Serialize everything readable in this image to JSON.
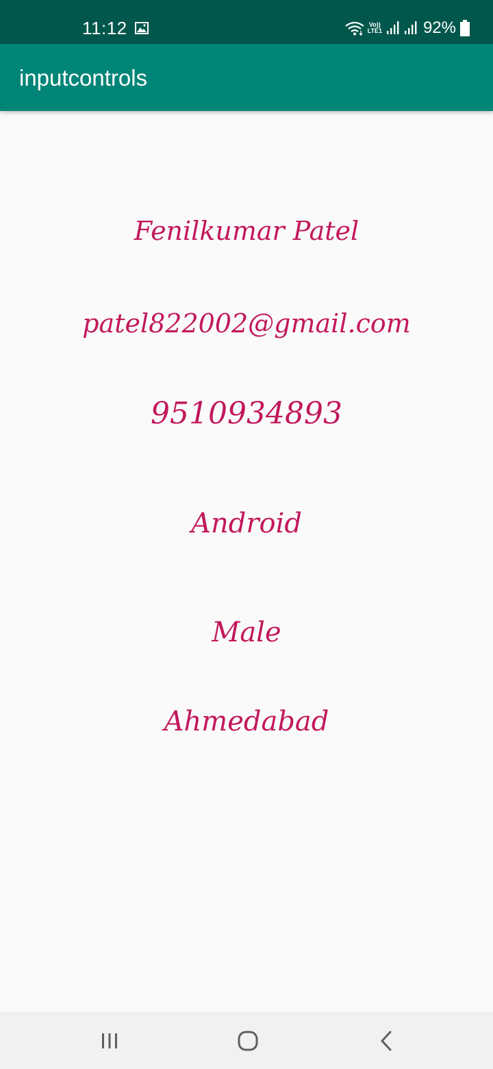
{
  "status_bar": {
    "time": "11:12",
    "volte_label_top": "Vo))",
    "volte_label_bottom": "LTE1",
    "battery_percent": "92%",
    "icons": [
      "gallery-icon",
      "wifi-icon",
      "signal-icon",
      "signal-icon",
      "battery-icon"
    ]
  },
  "app_bar": {
    "title": "inputcontrols"
  },
  "fields": {
    "name": "Fenilkumar Patel",
    "email": "patel822002@gmail.com",
    "phone": "9510934893",
    "course": "Android",
    "gender": "Male",
    "city": "Ahmedabad"
  },
  "nav_bar": {
    "buttons": [
      "recent-apps-icon",
      "home-icon",
      "back-icon"
    ]
  },
  "colors": {
    "status_bar": "#01574b",
    "app_bar": "#008577",
    "accent_text": "#c2185b",
    "background": "#fafafa",
    "nav_bar": "#f1f1f1"
  }
}
